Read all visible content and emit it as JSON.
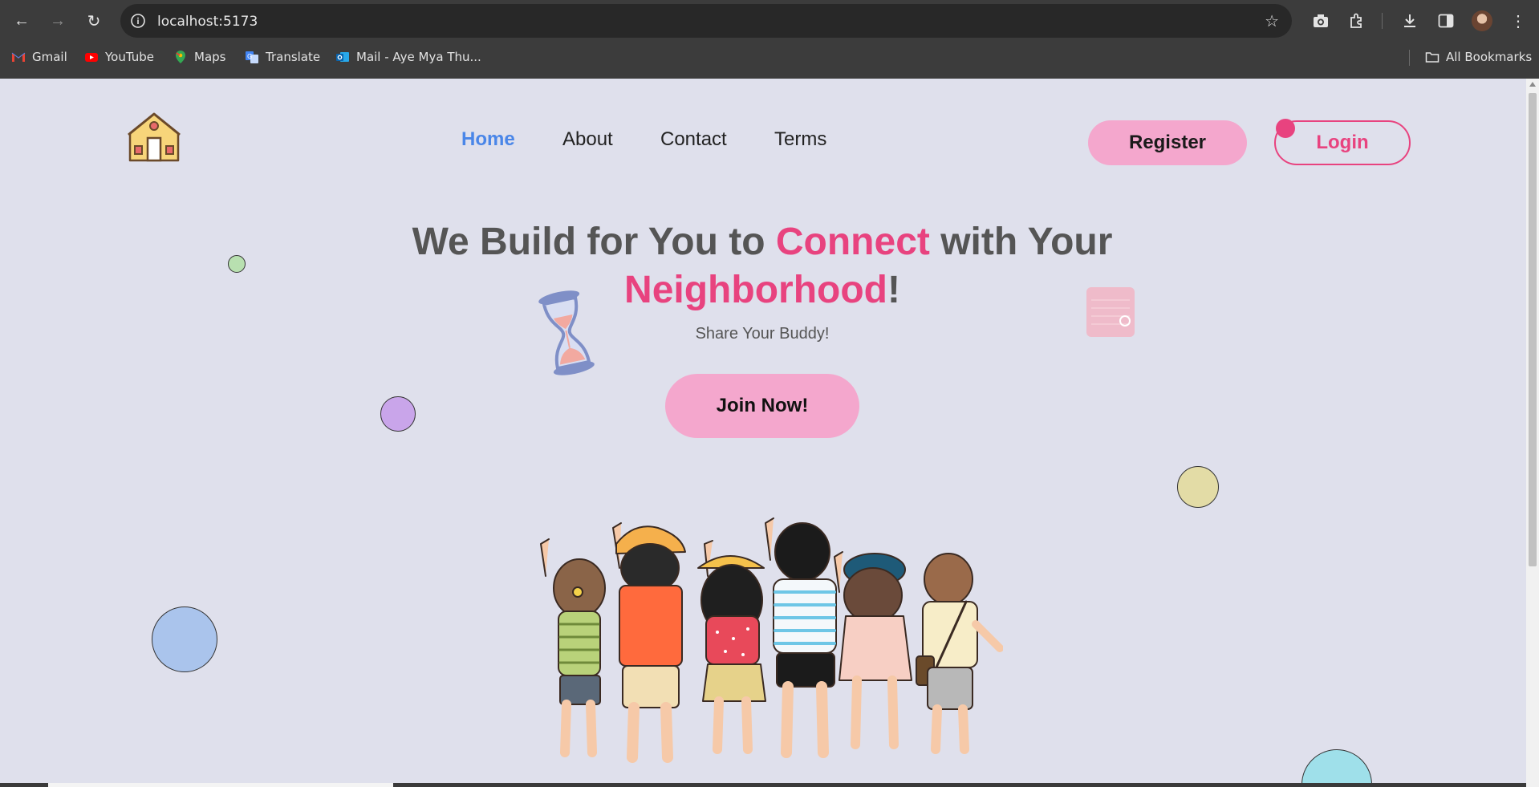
{
  "browser": {
    "url": "localhost:5173",
    "bookmarks": [
      {
        "label": "Gmail",
        "icon": "gmail-icon"
      },
      {
        "label": "YouTube",
        "icon": "youtube-icon"
      },
      {
        "label": "Maps",
        "icon": "maps-icon"
      },
      {
        "label": "Translate",
        "icon": "translate-icon"
      },
      {
        "label": "Mail - Aye Mya Thu...",
        "icon": "outlook-icon"
      }
    ],
    "all_bookmarks": "All Bookmarks"
  },
  "nav": {
    "items": [
      "Home",
      "About",
      "Contact",
      "Terms"
    ],
    "active": "Home",
    "register": "Register",
    "login": "Login"
  },
  "hero": {
    "title_part1": "We Build for You to ",
    "title_highlight1": "Connect",
    "title_part2": " with Your",
    "title_highlight2": "Neighborhood",
    "title_end": "!",
    "subtitle": "Share Your Buddy!",
    "cta": "Join Now!"
  },
  "colors": {
    "accent_pink": "#e8437f",
    "button_pink": "#f4a7cd",
    "nav_active": "#4a86e8",
    "background": "#dfe0ec"
  }
}
